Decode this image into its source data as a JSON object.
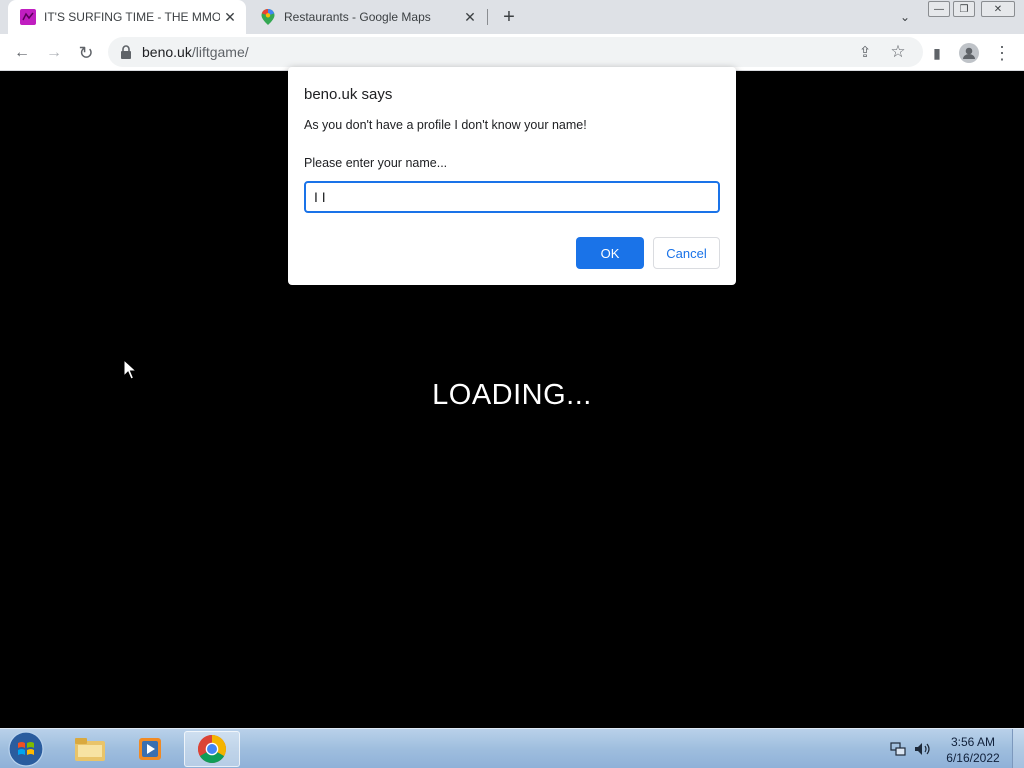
{
  "browser": {
    "tabs": [
      {
        "title": "IT'S SURFING TIME - THE MMOG",
        "active": true,
        "close": "✕"
      },
      {
        "title": "Restaurants - Google Maps",
        "active": false,
        "close": "✕"
      }
    ],
    "new_tab": "+",
    "tab_list": "⌄",
    "window_controls": {
      "minimize": "—",
      "restore": "❐",
      "close": "✕"
    },
    "toolbar": {
      "back": "←",
      "forward": "→",
      "reload": "↻",
      "url_domain": "beno.uk",
      "url_path": "/liftgame/",
      "share": "⇪",
      "bookmark": "☆",
      "side_panel": "▮",
      "profile": "●",
      "menu": "⋮"
    }
  },
  "page": {
    "loading_text": "LOADING..."
  },
  "dialog": {
    "origin": "beno.uk says",
    "message": "As you don't have a profile I don't know your name!",
    "prompt": "Please enter your name...",
    "input_value": "I I",
    "ok_label": "OK",
    "cancel_label": "Cancel"
  },
  "taskbar": {
    "time": "3:56 AM",
    "date": "6/16/2022",
    "items": [
      "file-explorer-icon",
      "media-player-icon",
      "chrome-icon"
    ]
  },
  "colors": {
    "accent": "#1a73e8",
    "page_background": "#000000",
    "tabstrip": "#dee1e6"
  }
}
